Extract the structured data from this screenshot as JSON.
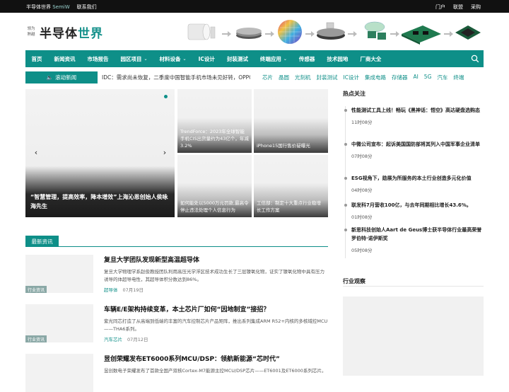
{
  "topbar": {
    "site_name": "半导体世界",
    "site_short": "SemiW",
    "contact": "联系我们",
    "right_links": [
      "门户",
      "联盟",
      "采购"
    ]
  },
  "logo": {
    "small_top": "领为",
    "small_bottom": "熟越",
    "name_main": "半导体",
    "name_accent": "世界"
  },
  "nav": {
    "items": [
      {
        "label": "首页",
        "dropdown": false
      },
      {
        "label": "新闻资讯",
        "dropdown": false
      },
      {
        "label": "市场报告",
        "dropdown": false
      },
      {
        "label": "园区项目",
        "dropdown": true
      },
      {
        "label": "材料设备",
        "dropdown": true
      },
      {
        "label": "IC设计",
        "dropdown": false
      },
      {
        "label": "封装测试",
        "dropdown": false
      },
      {
        "label": "终端应用",
        "dropdown": true
      },
      {
        "label": "传感器",
        "dropdown": false
      },
      {
        "label": "技术园地",
        "dropdown": false
      },
      {
        "label": "厂商大全",
        "dropdown": false
      }
    ],
    "search_icon": "search-icon"
  },
  "ticker": {
    "label": "滚动新闻",
    "text": "IDC：需求尚未恢复，二季度中国智能手机市场未见好转，OPPO..."
  },
  "tags": [
    "芯片",
    "晶圆",
    "光刻机",
    "封装测试",
    "IC设计",
    "集成电路",
    "存储器",
    "AI",
    "5G",
    "汽车",
    "终端"
  ],
  "slider": {
    "caption": "“智慧管理，提高效率，降本增效”上海沁恩创始人侯咏海先生",
    "active_dot_color": "#0e8f88"
  },
  "tiles": [
    {
      "caption": "TrendForce：2023年全球智能手机CIS出货量约为43亿个，年减3.2%"
    },
    {
      "caption": "iPhone15国行售价疑曝光"
    },
    {
      "caption": "如何能处以5000万元罚款,最高令停止违法处理个人信息行为"
    },
    {
      "caption": "工信部：制定十大重点行业稳增长工作方案"
    }
  ],
  "hot": {
    "title": "热点关注",
    "items": [
      {
        "text": "性能测试工具上线！畅玩《黑神话：悟空》高达硬盘选购态",
        "time": "11时08分"
      },
      {
        "text": "中微公司宣布：起诉美国国防部将其列入中国军事企业清单",
        "time": "07时08分"
      },
      {
        "text": "ESG视角下，勋展为所服务的本土行业创造多元化价值",
        "time": "04时08分"
      },
      {
        "text": "联发科7月营收100亿，与去年同期相比增长43.6%。",
        "time": "01时08分"
      },
      {
        "text": "新思科技创始人Aart de Geus博士获半导体行业最高荣誉罗伯特·诺伊斯奖",
        "time": "05时08分"
      }
    ]
  },
  "observe": {
    "title": "行业观察"
  },
  "latest": {
    "tab": "最新资讯",
    "articles": [
      {
        "title": "复旦大学团队发现新型高温超导体",
        "desc": "复旦大学物理学系赵俊教授团队利用高压光学浮区技术成功生长了三层镍氧化物，证实了镍氧化物中具有压力诱导的体超导电性，其超导体积分数达到86%。",
        "category": "超导体",
        "date": "07月19日",
        "tag": "行业资讯"
      },
      {
        "title": "车辆E/E架构持续变革，本土芯片厂如何“因地制宜”接招？",
        "desc": "紫光同芯打造了从高端到低端的丰富的汽车控制芯片产品矩阵，推出系列集成ARM R52+内核的多核域控MCU——THA6系列。",
        "category": "汽车芯片",
        "date": "07月12日",
        "tag": "行业资讯"
      },
      {
        "title": "昱创荣耀发布ET6000系列MCU/DSP：领航新能源“芯时代”",
        "desc": "昱创数电子荣耀发布了首款全国产双核Cortex-M7能源主控MCU/DSP芯片——ET6001及ET6000系列芯片。",
        "category": "",
        "date": "",
        "tag": ""
      }
    ]
  }
}
